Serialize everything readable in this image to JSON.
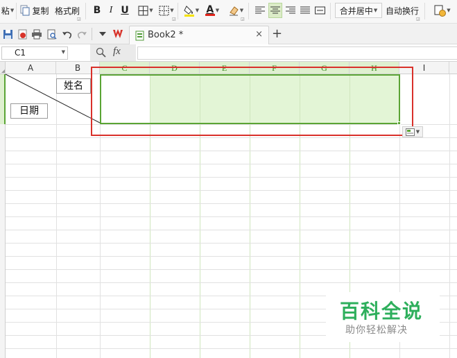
{
  "ribbon": {
    "paste_label": "粘",
    "copy_label": "复制",
    "format_painter_label": "格式刷",
    "bold_label": "B",
    "italic_label": "I",
    "underline_label": "U",
    "font_color_letter": "A",
    "merge_center_label": "合并居中",
    "auto_wrap_label": "自动换行",
    "font_color": "#e0261c",
    "highlight_color": "#f5e300"
  },
  "quickbar": {
    "tab_label": "Book2 *",
    "close_label": "×",
    "new_tab_label": "+"
  },
  "formula_bar": {
    "cell_ref": "C1",
    "fx_label": "fx",
    "formula_value": ""
  },
  "sheet": {
    "columns": [
      "A",
      "B",
      "C",
      "D",
      "E",
      "F",
      "G",
      "H",
      "I"
    ],
    "selected_columns": [
      "C",
      "D",
      "E",
      "F",
      "G",
      "H"
    ],
    "cell_name_label": "姓名",
    "cell_date_label": "日期",
    "selection_color": "#e3f5d6",
    "selection_border_color": "#5aa434",
    "annotation_border_color": "#d9302a"
  },
  "watermark": {
    "title": "百科全说",
    "subtitle": "助你轻松解决"
  }
}
